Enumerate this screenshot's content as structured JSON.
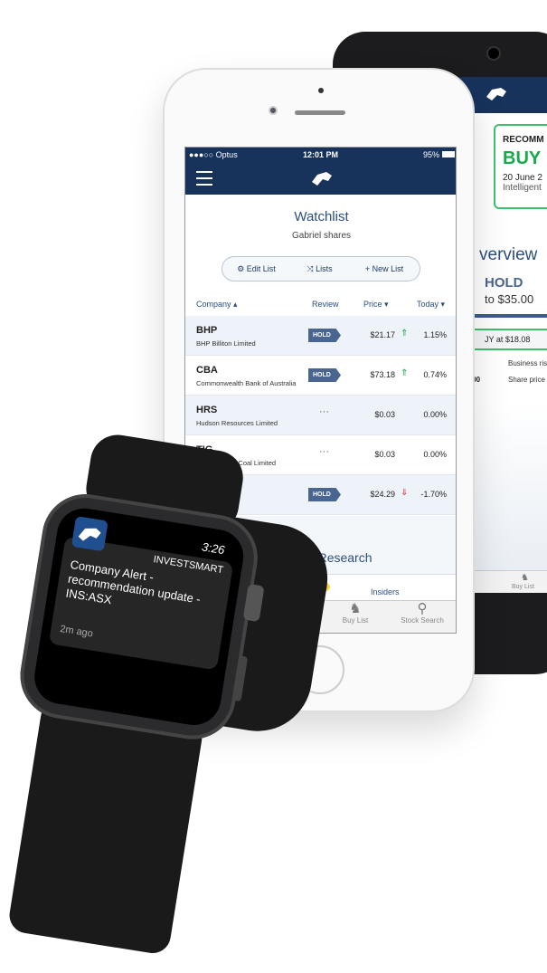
{
  "android": {
    "recommendation_label": "RECOMM",
    "recommendation": "BUY",
    "date": "20 June 2",
    "source": "Intelligent",
    "overview_title": "verview",
    "overview_rating": "HOLD",
    "overview_range": "to $35.00",
    "buy_at": "JY at $18.08",
    "business_risk": "Business risk",
    "share_price_value": ".00",
    "share_price_risk": "Share price risk",
    "tab_buy_list": "Buy List",
    "colors": {
      "nav": "#17335c",
      "buy": "#19a84a"
    }
  },
  "iphone": {
    "status": {
      "carrier": "●●●○○ Optus",
      "time": "12:01 PM",
      "battery": "95%"
    },
    "title": "Watchlist",
    "subtitle": "Gabriel shares",
    "buttons": {
      "edit": "Edit List",
      "lists": "Lists",
      "new": "New List"
    },
    "columns": {
      "company": "Company ▴",
      "review": "Review",
      "price": "Price ▾",
      "today": "Today ▾"
    },
    "rows": [
      {
        "ticker": "BHP",
        "name": "BHP Billiton Limited",
        "review": "HOLD",
        "price": "$21.17",
        "direction": "up",
        "change": "1.15%"
      },
      {
        "ticker": "CBA",
        "name": "Commonwealth Bank of Australia",
        "review": "HOLD",
        "price": "$73.18",
        "direction": "up",
        "change": "0.74%"
      },
      {
        "ticker": "HRS",
        "name": "Hudson Resources Limited",
        "review": "···",
        "price": "$0.03",
        "direction": "",
        "change": "0.00%"
      },
      {
        "ticker": "TIG",
        "name": "Tigers Realm Coal Limited",
        "review": "···",
        "price": "$0.03",
        "direction": "",
        "change": "0.00%"
      },
      {
        "ticker": "",
        "name": "",
        "review": "HOLD",
        "price": "$24.29",
        "direction": "down",
        "change": "-1.70%"
      }
    ],
    "section": "News & Research",
    "subtabs": {
      "announcements": "nts",
      "badge": "28",
      "insiders": "Insiders"
    },
    "tabbar": {
      "buy_list": "Buy List",
      "stock_search": "Stock Search"
    },
    "colors": {
      "nav": "#17335c",
      "up": "#19a84a",
      "down": "#e0323c",
      "badge": "#4a6590"
    }
  },
  "watch": {
    "time": "3:26",
    "app": "INVESTSMART",
    "message": "Company Alert - recommendation update - INS:ASX",
    "ago": "2m ago"
  }
}
